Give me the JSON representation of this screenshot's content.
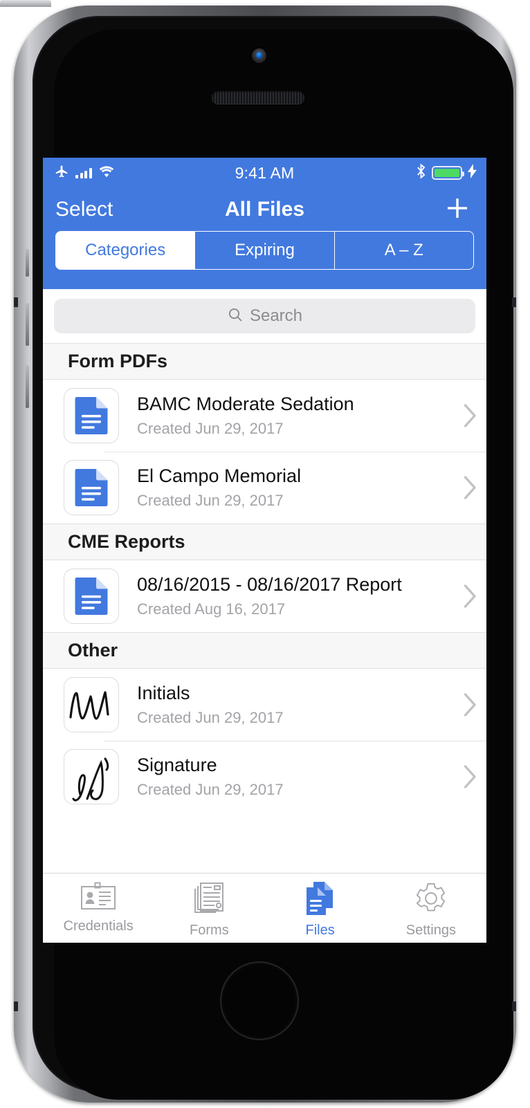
{
  "status_bar": {
    "airplane_icon": "airplane-mode-icon",
    "signal_icon": "cellular-signal-icon",
    "wifi_icon": "wifi-icon",
    "time": "9:41 AM",
    "bluetooth_icon": "bluetooth-icon",
    "battery_icon": "battery-icon",
    "charging_icon": "charging-bolt-icon"
  },
  "nav": {
    "left_label": "Select",
    "title": "All Files",
    "right_icon": "plus-icon"
  },
  "segmented": {
    "options": [
      {
        "label": "Categories",
        "selected": true
      },
      {
        "label": "Expiring",
        "selected": false
      },
      {
        "label": "A – Z",
        "selected": false
      }
    ]
  },
  "search": {
    "placeholder": "Search",
    "value": "",
    "icon": "search-icon"
  },
  "sections": [
    {
      "header": "Form PDFs",
      "rows": [
        {
          "title": "BAMC Moderate Sedation",
          "subtitle": "Created Jun 29, 2017",
          "thumb": "pdf-document-icon"
        },
        {
          "title": "El Campo Memorial",
          "subtitle": "Created Jun 29, 2017",
          "thumb": "pdf-document-icon"
        }
      ]
    },
    {
      "header": "CME Reports",
      "rows": [
        {
          "title": "08/16/2015 - 08/16/2017 Report",
          "subtitle": "Created Aug 16, 2017",
          "thumb": "pdf-document-icon"
        }
      ]
    },
    {
      "header": "Other",
      "rows": [
        {
          "title": "Initials",
          "subtitle": "Created Jun 29, 2017",
          "thumb": "initials-scribble-icon"
        },
        {
          "title": "Signature",
          "subtitle": "Created Jun 29, 2017",
          "thumb": "signature-scribble-icon"
        }
      ]
    }
  ],
  "tabbar": {
    "tabs": [
      {
        "label": "Credentials",
        "icon": "id-card-icon",
        "active": false
      },
      {
        "label": "Forms",
        "icon": "forms-stack-icon",
        "active": false
      },
      {
        "label": "Files",
        "icon": "files-documents-icon",
        "active": true
      },
      {
        "label": "Settings",
        "icon": "gear-icon",
        "active": false
      }
    ]
  },
  "colors": {
    "accent": "#4279df",
    "battery_green": "#4cd964",
    "section_header_bg": "#f7f7f7",
    "subtitle_gray": "#a3a3a8"
  }
}
